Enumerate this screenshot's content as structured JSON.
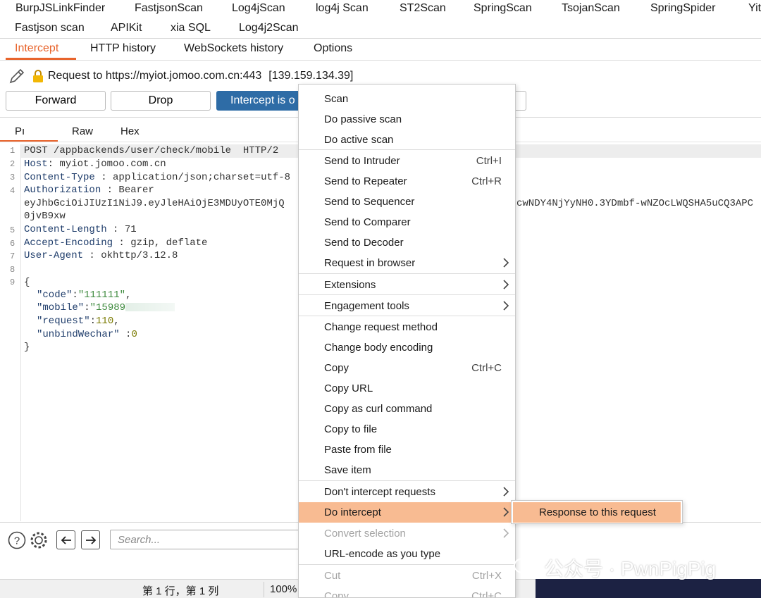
{
  "extension_tabs": {
    "row1": [
      "BurpJSLinkFinder",
      "FastjsonScan",
      "Log4jScan",
      "log4j Scan",
      "ST2Scan",
      "SpringScan",
      "TsojanScan",
      "SpringSpider",
      "Yit"
    ],
    "row2": [
      "Fastjson scan",
      "APIKit",
      "xia SQL",
      "Log4j2Scan"
    ]
  },
  "proxy_tabs": [
    "Intercept",
    "HTTP history",
    "WebSockets history",
    "Options"
  ],
  "request": {
    "label": "Request to https://myiot.jomoo.com.cn:443",
    "ip": "[139.159.134.39]"
  },
  "buttons": {
    "forward": "Forward",
    "drop": "Drop",
    "intercept": "Intercept is o"
  },
  "editor_tabs": [
    "Pı",
    "Raw",
    "Hex"
  ],
  "code_lines": {
    "l1": "POST /appbackends/user/check/mobile  HTTP/2",
    "l2_key": "Host",
    "l2_val": ": myiot.jomoo.com.cn",
    "l3_key": "Content-Type",
    "l3_val": " : application/json;charset=utf-8",
    "l4_key": "Authorization",
    "l4_val": " : Bearer",
    "l4_cont_a": "eyJhbGciOiJIUzI1NiJ9.eyJleHAiOjE3MDUyOTE0MjQ",
    "l4_cont_b": "cwNDY4NjYyNH0.3YDmbf-wNZOcLWQSHA5uCQ3APC",
    "l4_cont_c": "0jvB9xw",
    "l5_key": "Content-Length",
    "l5_val": " : 71",
    "l6_key": "Accept-Encoding",
    "l6_val": " : gzip, deflate",
    "l7_key": "User-Agent",
    "l7_val": " : okhttp/3.12.8",
    "l9": "{",
    "j_code_key": "\"code\"",
    "j_code_val": "\"111111\"",
    "j_mobile_key": "\"mobile\"",
    "j_mobile_val": "\"15989",
    "j_request_key": "\"request\"",
    "j_request_val": "110",
    "j_unbind_key": "\"unbindWechar\"",
    "j_unbind_val": "0",
    "close": "}"
  },
  "line_numbers": [
    "1",
    "2",
    "3",
    "4",
    "5",
    "6",
    "7",
    "8",
    "9"
  ],
  "search": {
    "placeholder": "Search..."
  },
  "status": {
    "position": "第 1 行，第 1 列",
    "zoom": "100%"
  },
  "context_menu": {
    "items": [
      {
        "label": "Scan",
        "shortcut": ""
      },
      {
        "label": "Do passive scan",
        "shortcut": ""
      },
      {
        "label": "Do active scan",
        "shortcut": ""
      },
      {
        "label": "Send to Intruder",
        "shortcut": "Ctrl+I"
      },
      {
        "label": "Send to Repeater",
        "shortcut": "Ctrl+R"
      },
      {
        "label": "Send to Sequencer",
        "shortcut": ""
      },
      {
        "label": "Send to Comparer",
        "shortcut": ""
      },
      {
        "label": "Send to Decoder",
        "shortcut": ""
      },
      {
        "label": "Request in browser",
        "shortcut": ""
      },
      {
        "label": "Extensions",
        "shortcut": ""
      },
      {
        "label": "Engagement tools",
        "shortcut": ""
      },
      {
        "label": "Change request method",
        "shortcut": ""
      },
      {
        "label": "Change body encoding",
        "shortcut": ""
      },
      {
        "label": "Copy",
        "shortcut": "Ctrl+C"
      },
      {
        "label": "Copy URL",
        "shortcut": ""
      },
      {
        "label": "Copy as curl command",
        "shortcut": ""
      },
      {
        "label": "Copy to file",
        "shortcut": ""
      },
      {
        "label": "Paste from file",
        "shortcut": ""
      },
      {
        "label": "Save item",
        "shortcut": ""
      },
      {
        "label": "Don't intercept requests",
        "shortcut": ""
      },
      {
        "label": "Do intercept",
        "shortcut": ""
      },
      {
        "label": "Convert selection",
        "shortcut": ""
      },
      {
        "label": "URL-encode as you type",
        "shortcut": ""
      },
      {
        "label": "Cut",
        "shortcut": "Ctrl+X"
      },
      {
        "label": "Copy",
        "shortcut": "Ctrl+C"
      }
    ],
    "highlighted": "Do intercept",
    "submenu_item": "Response to this request"
  },
  "watermark": "公众号 · PwnPigPig",
  "colors": {
    "accent": "#e8642c",
    "highlight": "#f8bb92",
    "intercept_blue": "#2e6ca6"
  }
}
